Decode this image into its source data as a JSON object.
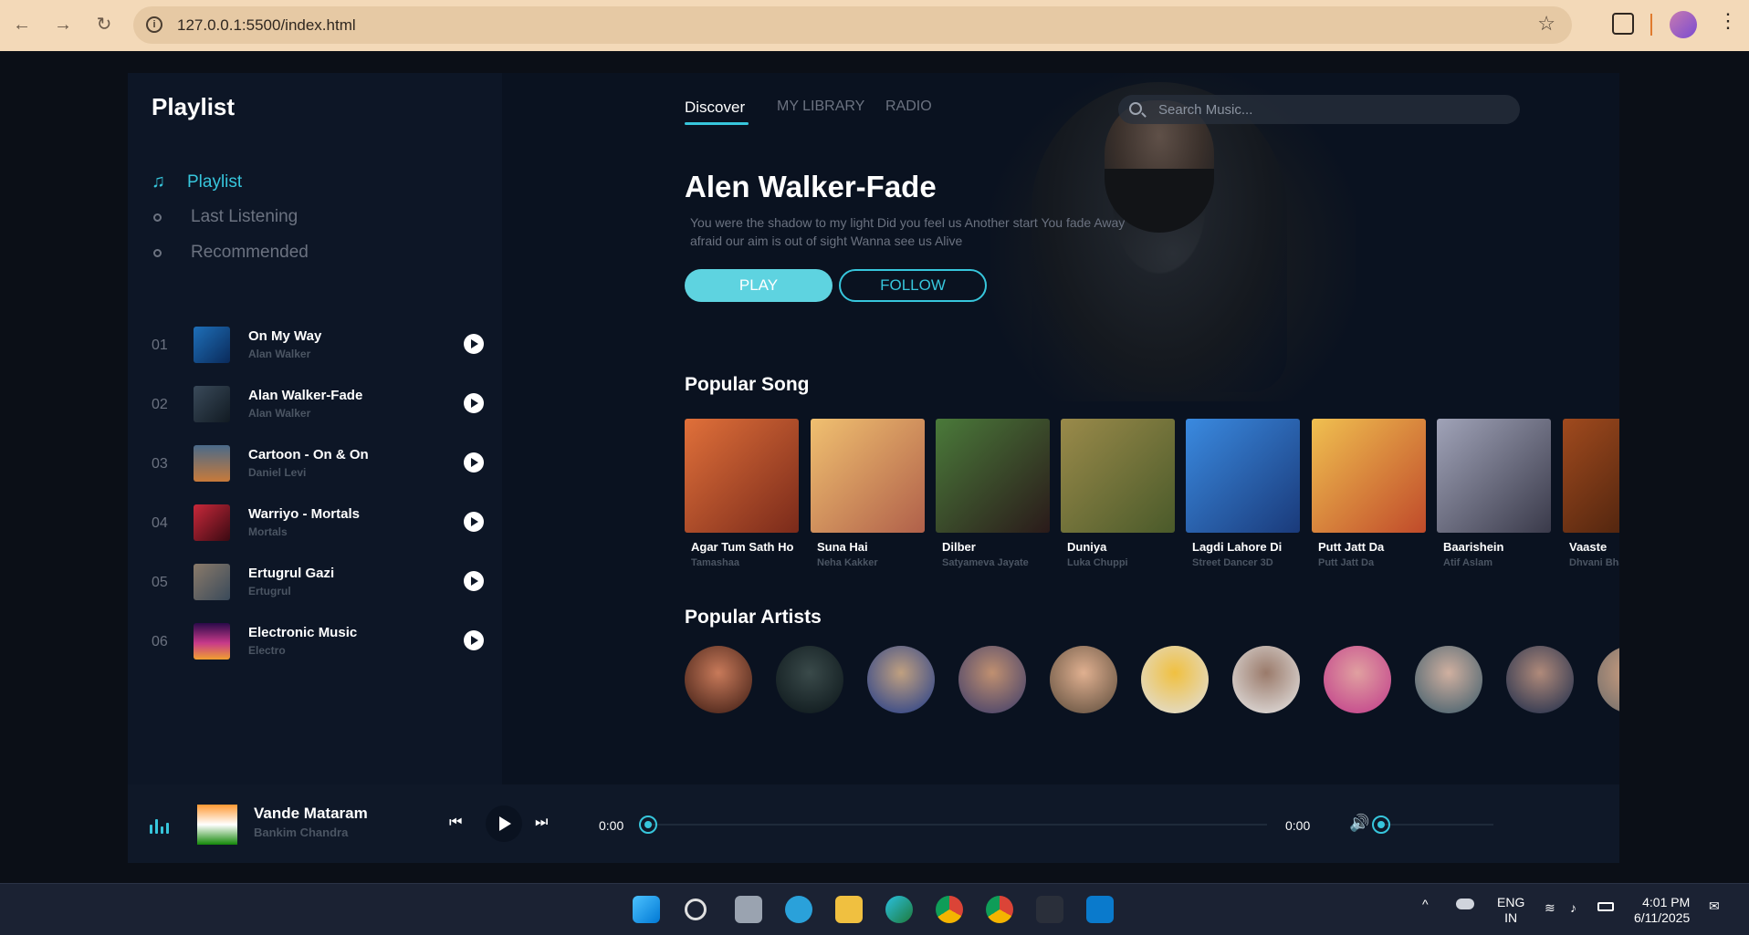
{
  "browser": {
    "url": "127.0.0.1:5500/index.html"
  },
  "sidebar": {
    "brand": "Playlist",
    "menu": [
      {
        "label": "Playlist",
        "active": true
      },
      {
        "label": "Last Listening",
        "active": false
      },
      {
        "label": "Recommended",
        "active": false
      }
    ],
    "tracks": [
      {
        "num": "01",
        "title": "On My Way",
        "artist": "Alan Walker"
      },
      {
        "num": "02",
        "title": "Alan Walker-Fade",
        "artist": "Alan Walker"
      },
      {
        "num": "03",
        "title": "Cartoon - On & On",
        "artist": "Daniel Levi"
      },
      {
        "num": "04",
        "title": "Warriyo - Mortals",
        "artist": "Mortals"
      },
      {
        "num": "05",
        "title": "Ertugrul Gazi",
        "artist": "Ertugrul"
      },
      {
        "num": "06",
        "title": "Electronic Music",
        "artist": "Electro"
      }
    ]
  },
  "header": {
    "tabs": [
      "Discover",
      "MY LIBRARY",
      "RADIO"
    ],
    "search_placeholder": "Search Music..."
  },
  "hero": {
    "title": "Alen Walker-Fade",
    "description": "You were the shadow to my light Did you feel us Another start You fade Away afraid our aim is out of sight Wanna see us Alive",
    "play_label": "PLAY",
    "follow_label": "FOLLOW"
  },
  "popular_songs": {
    "title": "Popular Song",
    "items": [
      {
        "title": "Agar Tum Sath Ho",
        "artist": "Tamashaa",
        "color": "#c5552e"
      },
      {
        "title": "Suna Hai",
        "artist": "Neha Kakker",
        "color": "#d9a24a"
      },
      {
        "title": "Dilber",
        "artist": "Satyameva Jayate",
        "color": "#3b6a2c"
      },
      {
        "title": "Duniya",
        "artist": "Luka Chuppi",
        "color": "#8a7a3c"
      },
      {
        "title": "Lagdi Lahore Di",
        "artist": "Street Dancer 3D",
        "color": "#2f6ec4"
      },
      {
        "title": "Putt Jatt Da",
        "artist": "Putt Jatt Da",
        "color": "#e8b84a"
      },
      {
        "title": "Baarishein",
        "artist": "Atif Aslam",
        "color": "#8c8fa3"
      },
      {
        "title": "Vaaste",
        "artist": "Dhvani Bhanushali",
        "color": "#7a3a1e"
      }
    ]
  },
  "popular_artists": {
    "title": "Popular Artists",
    "colors": [
      "#5a2a1e",
      "#1e2a2e",
      "#1e3a8a",
      "#3a3a6a",
      "#8a6a4a",
      "#e0a832",
      "#c8c8c8",
      "#c03a8a",
      "#5a7a8a",
      "#2a3a5a",
      "#6a6a6a"
    ]
  },
  "player": {
    "title": "Vande Mataram",
    "artist": "Bankim Chandra",
    "current_time": "0:00",
    "total_time": "0:00"
  },
  "taskbar": {
    "lang_top": "ENG",
    "lang_bottom": "IN",
    "time": "4:01 PM",
    "date": "6/11/2025"
  },
  "icons": {
    "back": "arrow-left-icon",
    "forward": "arrow-right-icon",
    "reload": "reload-icon",
    "bookmark": "star-icon",
    "music": "music-note-icon",
    "equalizer": "equalizer-icon",
    "volume": "volume-icon"
  }
}
